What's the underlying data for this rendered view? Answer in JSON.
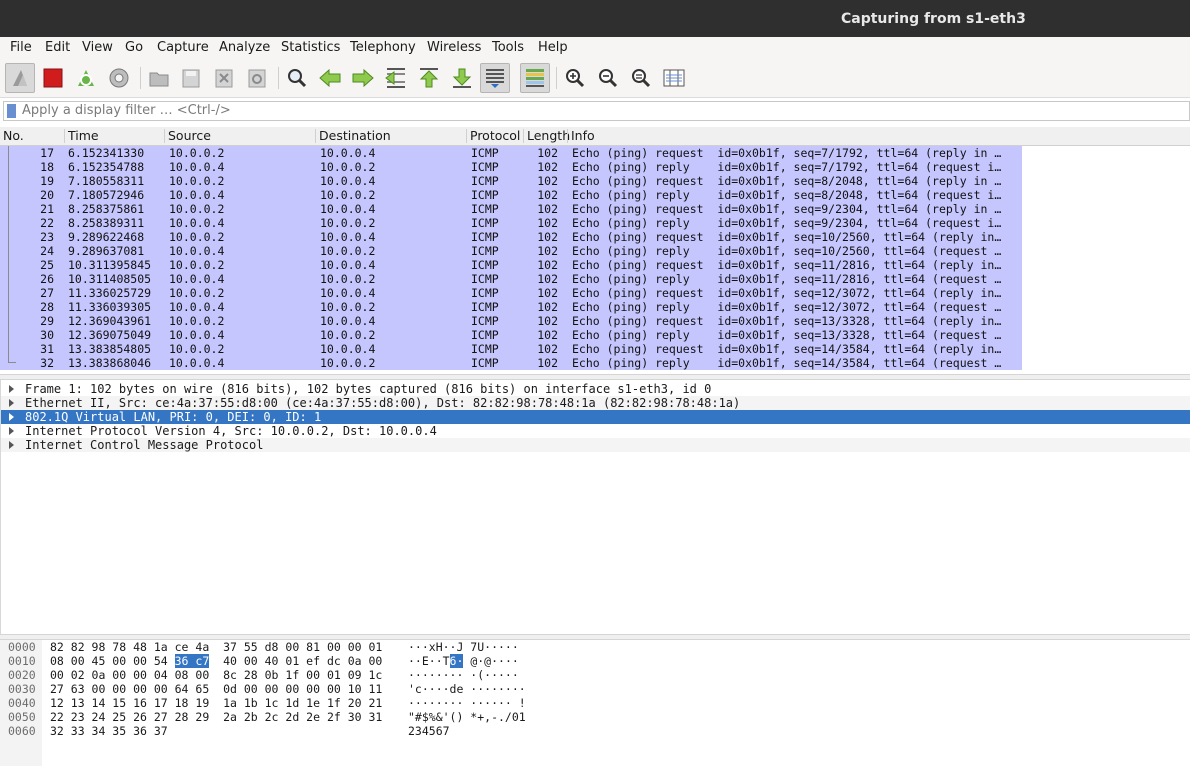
{
  "window": {
    "title": "Capturing from s1-eth3"
  },
  "menu": [
    "File",
    "Edit",
    "View",
    "Go",
    "Capture",
    "Analyze",
    "Statistics",
    "Telephony",
    "Wireless",
    "Tools",
    "Help"
  ],
  "toolbar": {
    "icons": [
      "start-capture-icon",
      "stop-capture-icon",
      "restart-capture-icon",
      "capture-options-icon",
      "open-file-icon",
      "save-file-icon",
      "close-file-icon",
      "reload-file-icon",
      "find-packet-icon",
      "go-back-icon",
      "go-forward-icon",
      "go-to-packet-icon",
      "first-packet-icon",
      "last-packet-icon",
      "autoscroll-icon",
      "colorize-icon",
      "zoom-in-icon",
      "zoom-out-icon",
      "normal-size-icon",
      "resize-columns-icon"
    ]
  },
  "filter": {
    "placeholder": "Apply a display filter … <Ctrl-/>",
    "value": ""
  },
  "columns": [
    "No.",
    "Time",
    "Source",
    "Destination",
    "Protocol",
    "Length",
    "Info"
  ],
  "packets": [
    {
      "no": "17",
      "time": "6.152341330",
      "src": "10.0.0.2",
      "dst": "10.0.0.4",
      "proto": "ICMP",
      "len": "102",
      "info": "Echo (ping) request  id=0x0b1f, seq=7/1792, ttl=64 (reply in …"
    },
    {
      "no": "18",
      "time": "6.152354788",
      "src": "10.0.0.4",
      "dst": "10.0.0.2",
      "proto": "ICMP",
      "len": "102",
      "info": "Echo (ping) reply    id=0x0b1f, seq=7/1792, ttl=64 (request i…"
    },
    {
      "no": "19",
      "time": "7.180558311",
      "src": "10.0.0.2",
      "dst": "10.0.0.4",
      "proto": "ICMP",
      "len": "102",
      "info": "Echo (ping) request  id=0x0b1f, seq=8/2048, ttl=64 (reply in …"
    },
    {
      "no": "20",
      "time": "7.180572946",
      "src": "10.0.0.4",
      "dst": "10.0.0.2",
      "proto": "ICMP",
      "len": "102",
      "info": "Echo (ping) reply    id=0x0b1f, seq=8/2048, ttl=64 (request i…"
    },
    {
      "no": "21",
      "time": "8.258375861",
      "src": "10.0.0.2",
      "dst": "10.0.0.4",
      "proto": "ICMP",
      "len": "102",
      "info": "Echo (ping) request  id=0x0b1f, seq=9/2304, ttl=64 (reply in …"
    },
    {
      "no": "22",
      "time": "8.258389311",
      "src": "10.0.0.4",
      "dst": "10.0.0.2",
      "proto": "ICMP",
      "len": "102",
      "info": "Echo (ping) reply    id=0x0b1f, seq=9/2304, ttl=64 (request i…"
    },
    {
      "no": "23",
      "time": "9.289622468",
      "src": "10.0.0.2",
      "dst": "10.0.0.4",
      "proto": "ICMP",
      "len": "102",
      "info": "Echo (ping) request  id=0x0b1f, seq=10/2560, ttl=64 (reply in…"
    },
    {
      "no": "24",
      "time": "9.289637081",
      "src": "10.0.0.4",
      "dst": "10.0.0.2",
      "proto": "ICMP",
      "len": "102",
      "info": "Echo (ping) reply    id=0x0b1f, seq=10/2560, ttl=64 (request …"
    },
    {
      "no": "25",
      "time": "10.311395845",
      "src": "10.0.0.2",
      "dst": "10.0.0.4",
      "proto": "ICMP",
      "len": "102",
      "info": "Echo (ping) request  id=0x0b1f, seq=11/2816, ttl=64 (reply in…"
    },
    {
      "no": "26",
      "time": "10.311408505",
      "src": "10.0.0.4",
      "dst": "10.0.0.2",
      "proto": "ICMP",
      "len": "102",
      "info": "Echo (ping) reply    id=0x0b1f, seq=11/2816, ttl=64 (request …"
    },
    {
      "no": "27",
      "time": "11.336025729",
      "src": "10.0.0.2",
      "dst": "10.0.0.4",
      "proto": "ICMP",
      "len": "102",
      "info": "Echo (ping) request  id=0x0b1f, seq=12/3072, ttl=64 (reply in…"
    },
    {
      "no": "28",
      "time": "11.336039305",
      "src": "10.0.0.4",
      "dst": "10.0.0.2",
      "proto": "ICMP",
      "len": "102",
      "info": "Echo (ping) reply    id=0x0b1f, seq=12/3072, ttl=64 (request …"
    },
    {
      "no": "29",
      "time": "12.369043961",
      "src": "10.0.0.2",
      "dst": "10.0.0.4",
      "proto": "ICMP",
      "len": "102",
      "info": "Echo (ping) request  id=0x0b1f, seq=13/3328, ttl=64 (reply in…"
    },
    {
      "no": "30",
      "time": "12.369075049",
      "src": "10.0.0.4",
      "dst": "10.0.0.2",
      "proto": "ICMP",
      "len": "102",
      "info": "Echo (ping) reply    id=0x0b1f, seq=13/3328, ttl=64 (request …"
    },
    {
      "no": "31",
      "time": "13.383854805",
      "src": "10.0.0.2",
      "dst": "10.0.0.4",
      "proto": "ICMP",
      "len": "102",
      "info": "Echo (ping) request  id=0x0b1f, seq=14/3584, ttl=64 (reply in…"
    },
    {
      "no": "32",
      "time": "13.383868046",
      "src": "10.0.0.4",
      "dst": "10.0.0.2",
      "proto": "ICMP",
      "len": "102",
      "info": "Echo (ping) reply    id=0x0b1f, seq=14/3584, ttl=64 (request …"
    }
  ],
  "details": [
    {
      "text": "Frame 1: 102 bytes on wire (816 bits), 102 bytes captured (816 bits) on interface s1-eth3, id 0",
      "selected": false
    },
    {
      "text": "Ethernet II, Src: ce:4a:37:55:d8:00 (ce:4a:37:55:d8:00), Dst: 82:82:98:78:48:1a (82:82:98:78:48:1a)",
      "selected": false
    },
    {
      "text": "802.1Q Virtual LAN, PRI: 0, DEI: 0, ID: 1",
      "selected": true
    },
    {
      "text": "Internet Protocol Version 4, Src: 10.0.0.2, Dst: 10.0.0.4",
      "selected": false
    },
    {
      "text": "Internet Control Message Protocol",
      "selected": false
    }
  ],
  "bytes": [
    {
      "offset": "0000",
      "hex_a": "82 82 98 78 48 1a ce 4a  37 55 d8 00 81 00 00 01",
      "hex_hl": "",
      "hex_b": "",
      "ascii_a": "···xH··J 7U·····",
      "ascii_hl": "",
      "ascii_b": ""
    },
    {
      "offset": "0010",
      "hex_a": "08 00 45 00 00 54 ",
      "hex_hl": "36 c7",
      "hex_b": "  40 00 40 01 ef dc 0a 00",
      "ascii_a": "··E··T",
      "ascii_hl": "6·",
      "ascii_b": " @·@····"
    },
    {
      "offset": "0020",
      "hex_a": "00 02 0a 00 00 04 08 00  8c 28 0b 1f 00 01 09 1c",
      "hex_hl": "",
      "hex_b": "",
      "ascii_a": "········ ·(·····",
      "ascii_hl": "",
      "ascii_b": ""
    },
    {
      "offset": "0030",
      "hex_a": "27 63 00 00 00 00 64 65  0d 00 00 00 00 00 10 11",
      "hex_hl": "",
      "hex_b": "",
      "ascii_a": "'c····de ········",
      "ascii_hl": "",
      "ascii_b": ""
    },
    {
      "offset": "0040",
      "hex_a": "12 13 14 15 16 17 18 19  1a 1b 1c 1d 1e 1f 20 21",
      "hex_hl": "",
      "hex_b": "",
      "ascii_a": "········ ······ !",
      "ascii_hl": "",
      "ascii_b": ""
    },
    {
      "offset": "0050",
      "hex_a": "22 23 24 25 26 27 28 29  2a 2b 2c 2d 2e 2f 30 31",
      "hex_hl": "",
      "hex_b": "",
      "ascii_a": "\"#$%&'() *+,-./01",
      "ascii_hl": "",
      "ascii_b": ""
    },
    {
      "offset": "0060",
      "hex_a": "32 33 34 35 36 37",
      "hex_hl": "",
      "hex_b": "",
      "ascii_a": "234567",
      "ascii_hl": "",
      "ascii_b": ""
    }
  ],
  "colors": {
    "row_bg": "#c6c6ff",
    "selection": "#3476c4",
    "titlebar": "#2f2f2f"
  }
}
